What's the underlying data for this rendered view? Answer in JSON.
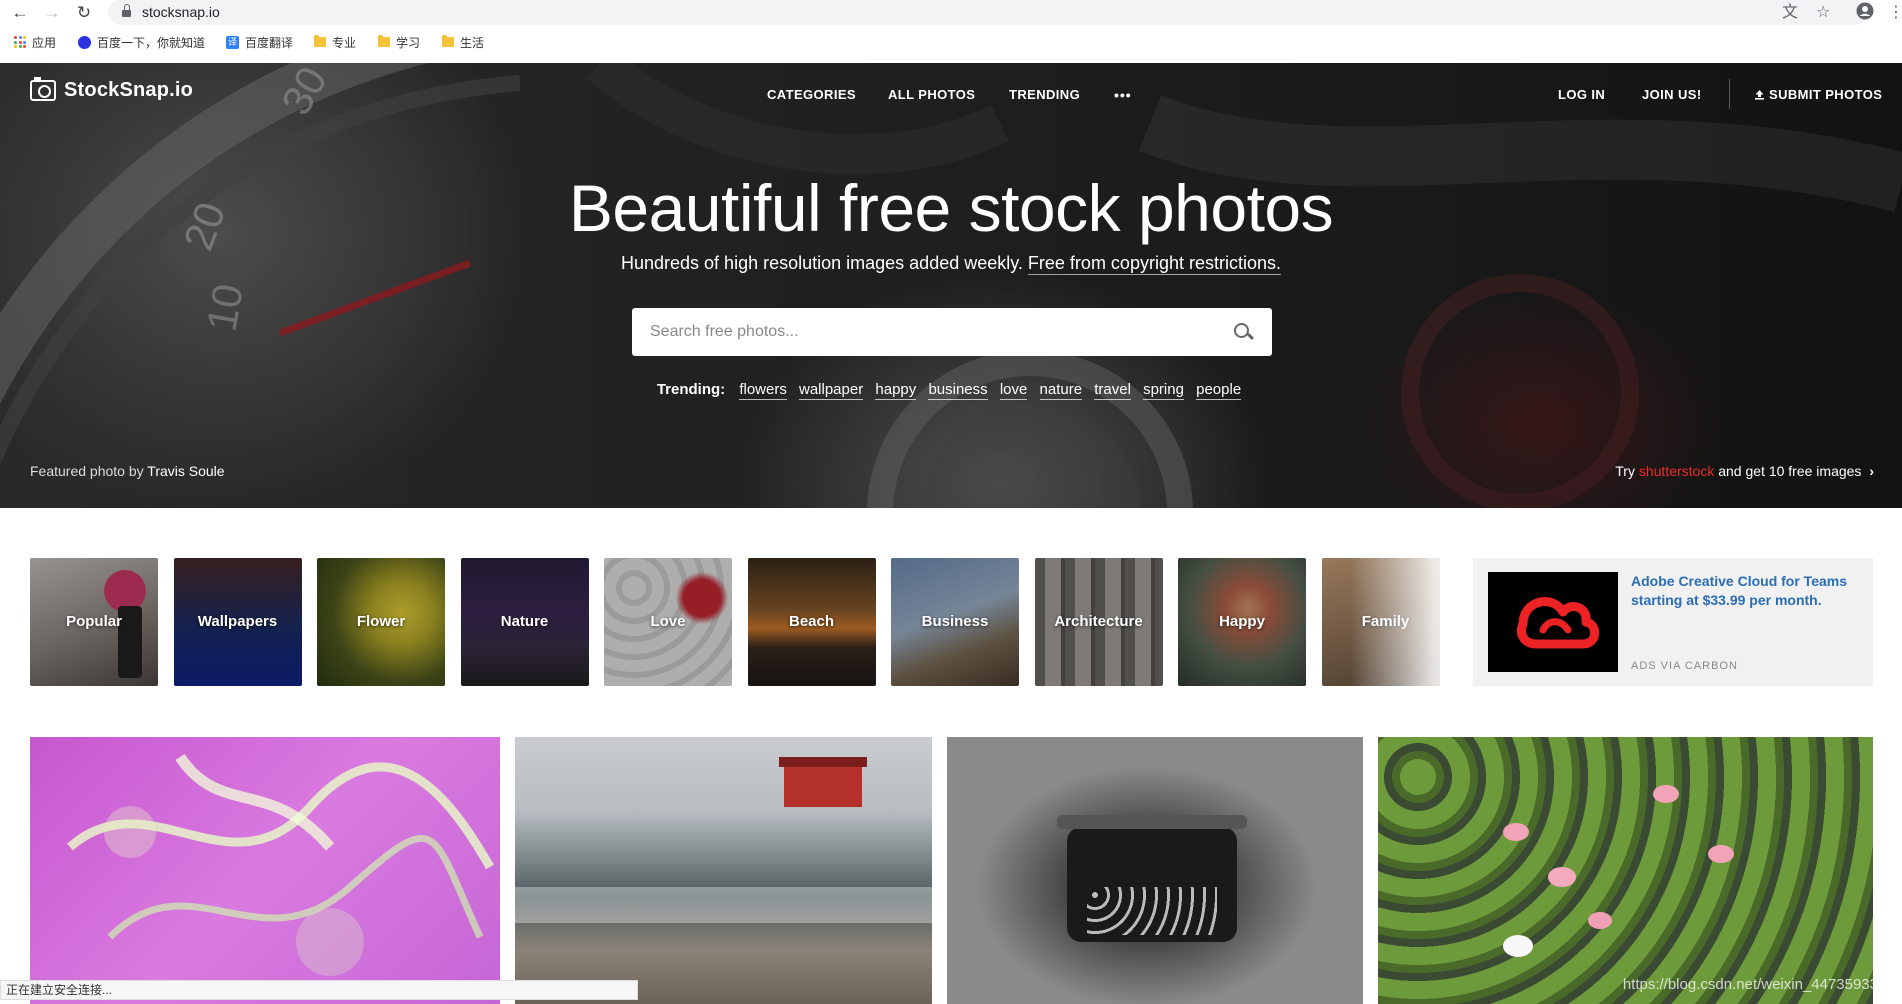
{
  "browser": {
    "url": "stocksnap.io",
    "bookmarks": [
      "应用",
      "百度一下，你就知道",
      "百度翻译",
      "专业",
      "学习",
      "生活"
    ]
  },
  "site": {
    "logo": "StockSnap.io",
    "nav": [
      "CATEGORIES",
      "ALL PHOTOS",
      "TRENDING",
      "•••"
    ],
    "login": "LOG IN",
    "join": "JOIN US!",
    "submit": "SUBMIT PHOTOS"
  },
  "hero": {
    "title": "Beautiful free stock photos",
    "subtitle": "Hundreds of high resolution images added weekly.",
    "subtitle_link": "Free from copyright restrictions.",
    "search_placeholder": "Search free photos...",
    "trending_label": "Trending:",
    "trending": [
      "flowers",
      "wallpaper",
      "happy",
      "business",
      "love",
      "nature",
      "travel",
      "spring",
      "people"
    ],
    "credit_prefix": "Featured photo by",
    "credit_name": "Travis Soule",
    "promo_try": "Try",
    "promo_brand": "shutterstock",
    "promo_rest": "and get 10 free images"
  },
  "categories": [
    "Popular",
    "Wallpapers",
    "Flower",
    "Nature",
    "Love",
    "Beach",
    "Business",
    "Architecture",
    "Happy",
    "Family"
  ],
  "ad": {
    "text": "Adobe Creative Cloud for Teams starting at $33.99 per month.",
    "via": "ADS VIA CARBON"
  },
  "status_bar": "正在建立安全连接...",
  "watermark": "https://blog.csdn.net/weixin_44735933"
}
